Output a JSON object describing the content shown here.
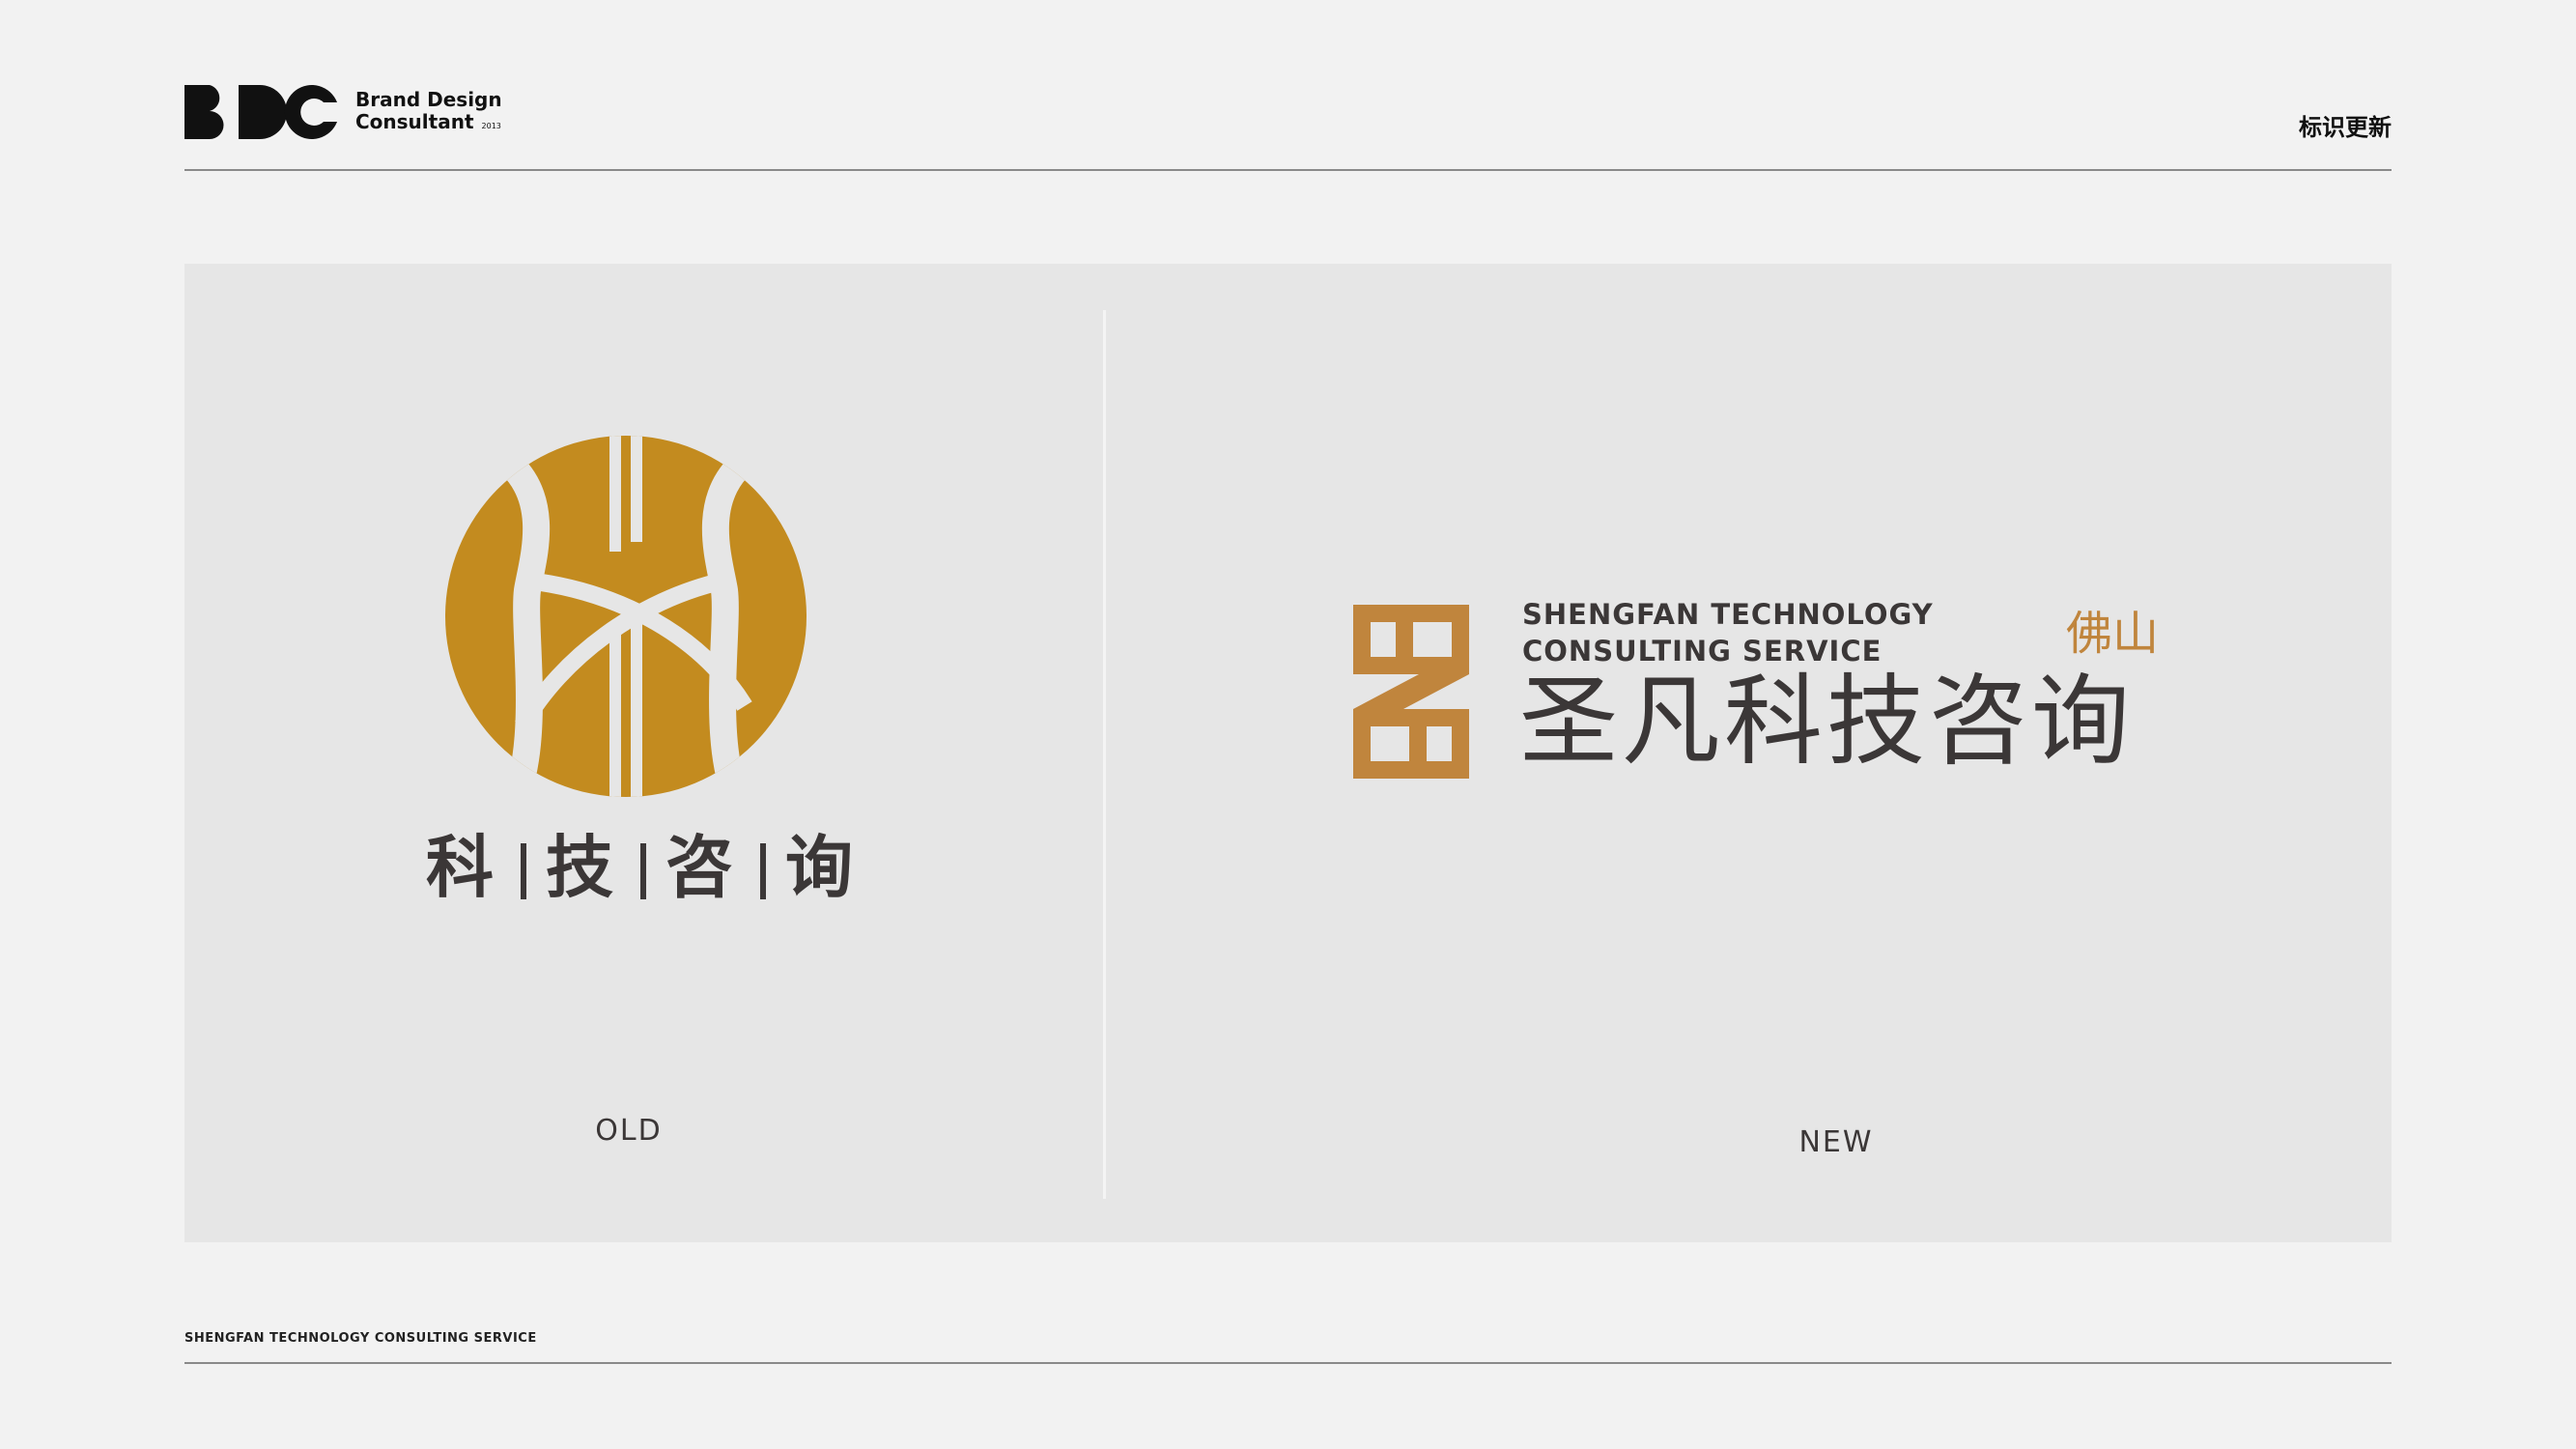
{
  "header": {
    "brand_mark": "BDC",
    "brand_line1": "Brand Design",
    "brand_line2": "Consultant",
    "brand_year": "2013",
    "page_tag": "标识更新"
  },
  "old": {
    "name_chars": [
      "科",
      "技",
      "咨",
      "询"
    ],
    "label": "OLD"
  },
  "new": {
    "en_line1": "SHENGFAN TECHNOLOGY",
    "en_line2": "CONSULTING SERVICE",
    "city": "佛山",
    "cn_name": "圣凡科技咨询",
    "label": "NEW"
  },
  "footer": {
    "text": "SHENGFAN TECHNOLOGY CONSULTING SERVICE"
  },
  "colors": {
    "old_gold": "#c38b1f",
    "new_gold": "#c0853d",
    "text_dark": "#3b3737",
    "panel": "#e6e6e6",
    "background": "#f2f2f2"
  }
}
